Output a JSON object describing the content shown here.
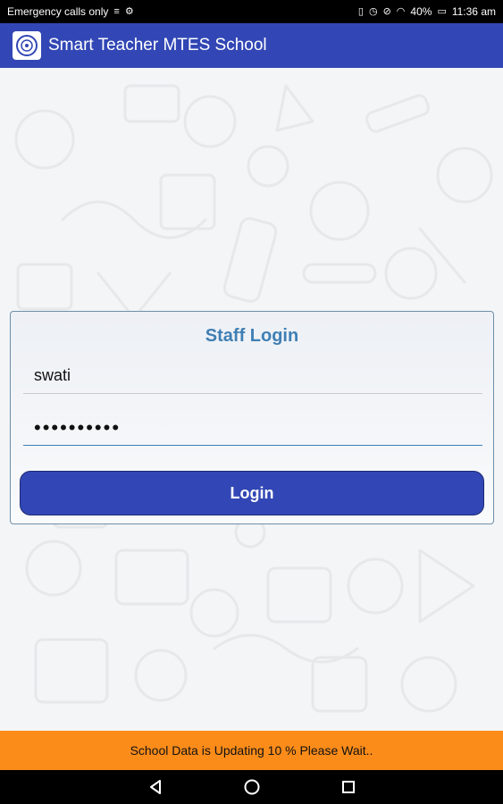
{
  "status_bar": {
    "left_text": "Emergency calls only",
    "battery": "40%",
    "time": "11:36 am"
  },
  "app": {
    "title": "Smart Teacher MTES School"
  },
  "login": {
    "title": "Staff Login",
    "username_value": "swati",
    "password_value": "••••••••••",
    "button_label": "Login"
  },
  "banner": {
    "text": "School Data is Updating 10 % Please Wait.."
  },
  "colors": {
    "primary": "#3247b5",
    "banner": "#fb8c1a",
    "title_blue": "#3f7fb4"
  },
  "icons": {
    "nav": [
      "back-icon",
      "home-icon",
      "recents-icon"
    ]
  }
}
